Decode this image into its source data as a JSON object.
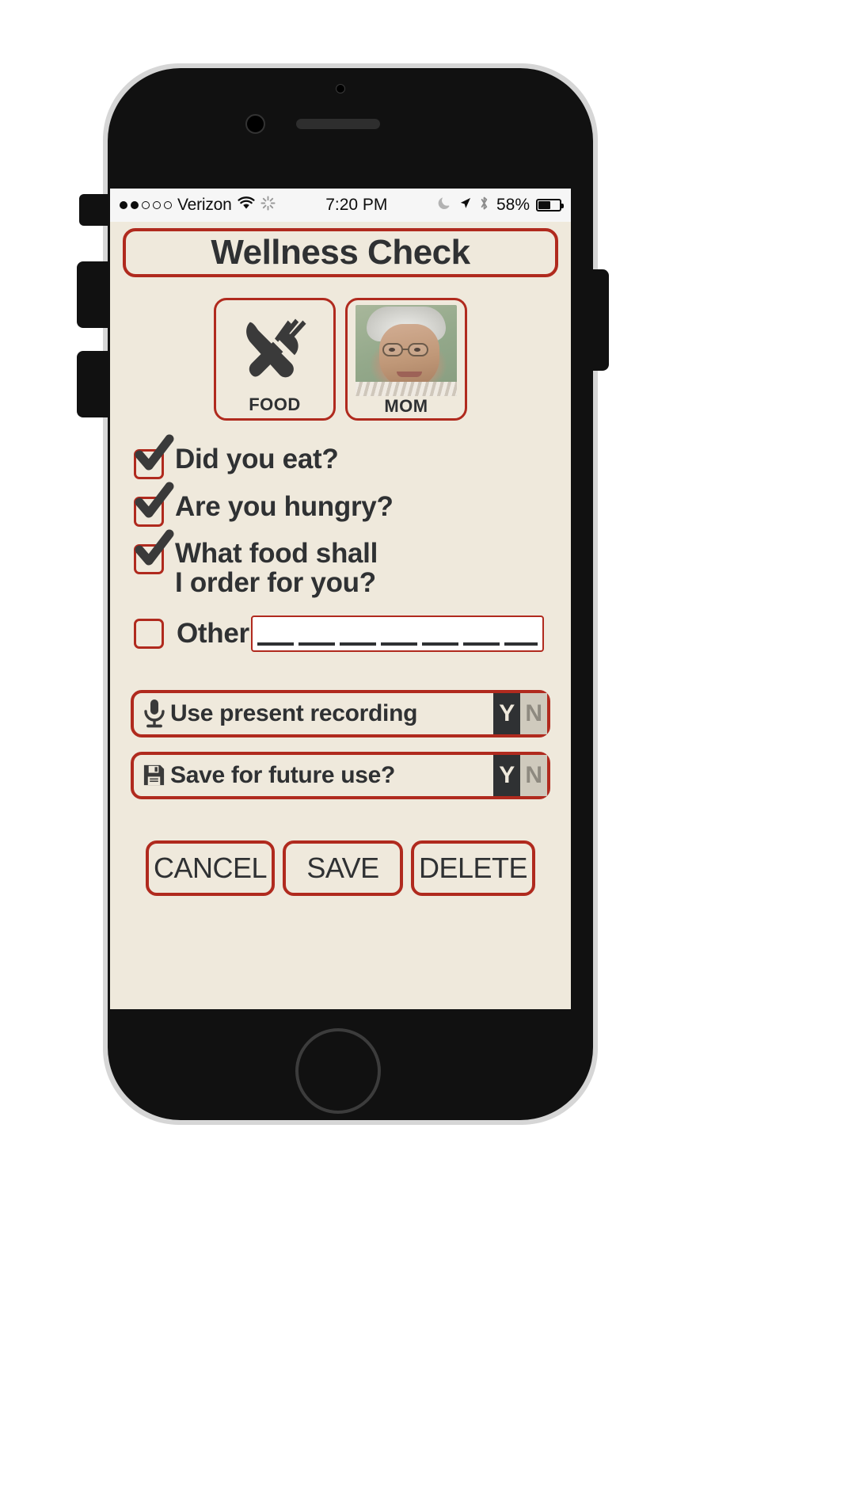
{
  "status_bar": {
    "signal_dots_filled": 2,
    "signal_dots_total": 5,
    "carrier": "Verizon",
    "wifi_icon": "wifi-icon",
    "activity_icon": "spinner-icon",
    "time": "7:20 PM",
    "dnd_icon": "moon-icon",
    "location_icon": "location-arrow-icon",
    "bluetooth_icon": "bluetooth-icon",
    "battery_percent": "58%",
    "battery_level": 58
  },
  "app": {
    "title": "Wellness Check",
    "cards": [
      {
        "label": "FOOD",
        "icon": "fork-knife-icon"
      },
      {
        "label": "MOM",
        "icon": "person-photo"
      }
    ],
    "questions": [
      {
        "label": "Did you eat?",
        "checked": true,
        "lines": [
          "Did you eat?"
        ]
      },
      {
        "label": "Are you hungry?",
        "checked": true,
        "lines": [
          "Are you hungry?"
        ]
      },
      {
        "label": "What food shall I order for you?",
        "checked": true,
        "lines": [
          "What food shall",
          "I order for you?"
        ]
      }
    ],
    "other": {
      "label": "Other",
      "checked": false,
      "value": "",
      "placeholder": ""
    },
    "banners": [
      {
        "icon": "microphone-icon",
        "label": "Use present recording",
        "yes_label": "Y",
        "no_label": "N",
        "selected": "Y"
      },
      {
        "icon": "floppy-disk-save-icon",
        "label": "Save for future use?",
        "yes_label": "Y",
        "no_label": "N",
        "selected": "Y"
      }
    ],
    "actions": [
      {
        "label": "CANCEL"
      },
      {
        "label": "SAVE"
      },
      {
        "label": "DELETE"
      }
    ]
  },
  "colors": {
    "accent_red": "#b02a1e",
    "screen_bg": "#efe9dc",
    "text_dark": "#2f3133",
    "statusbar_bg": "#f6f6f6"
  }
}
